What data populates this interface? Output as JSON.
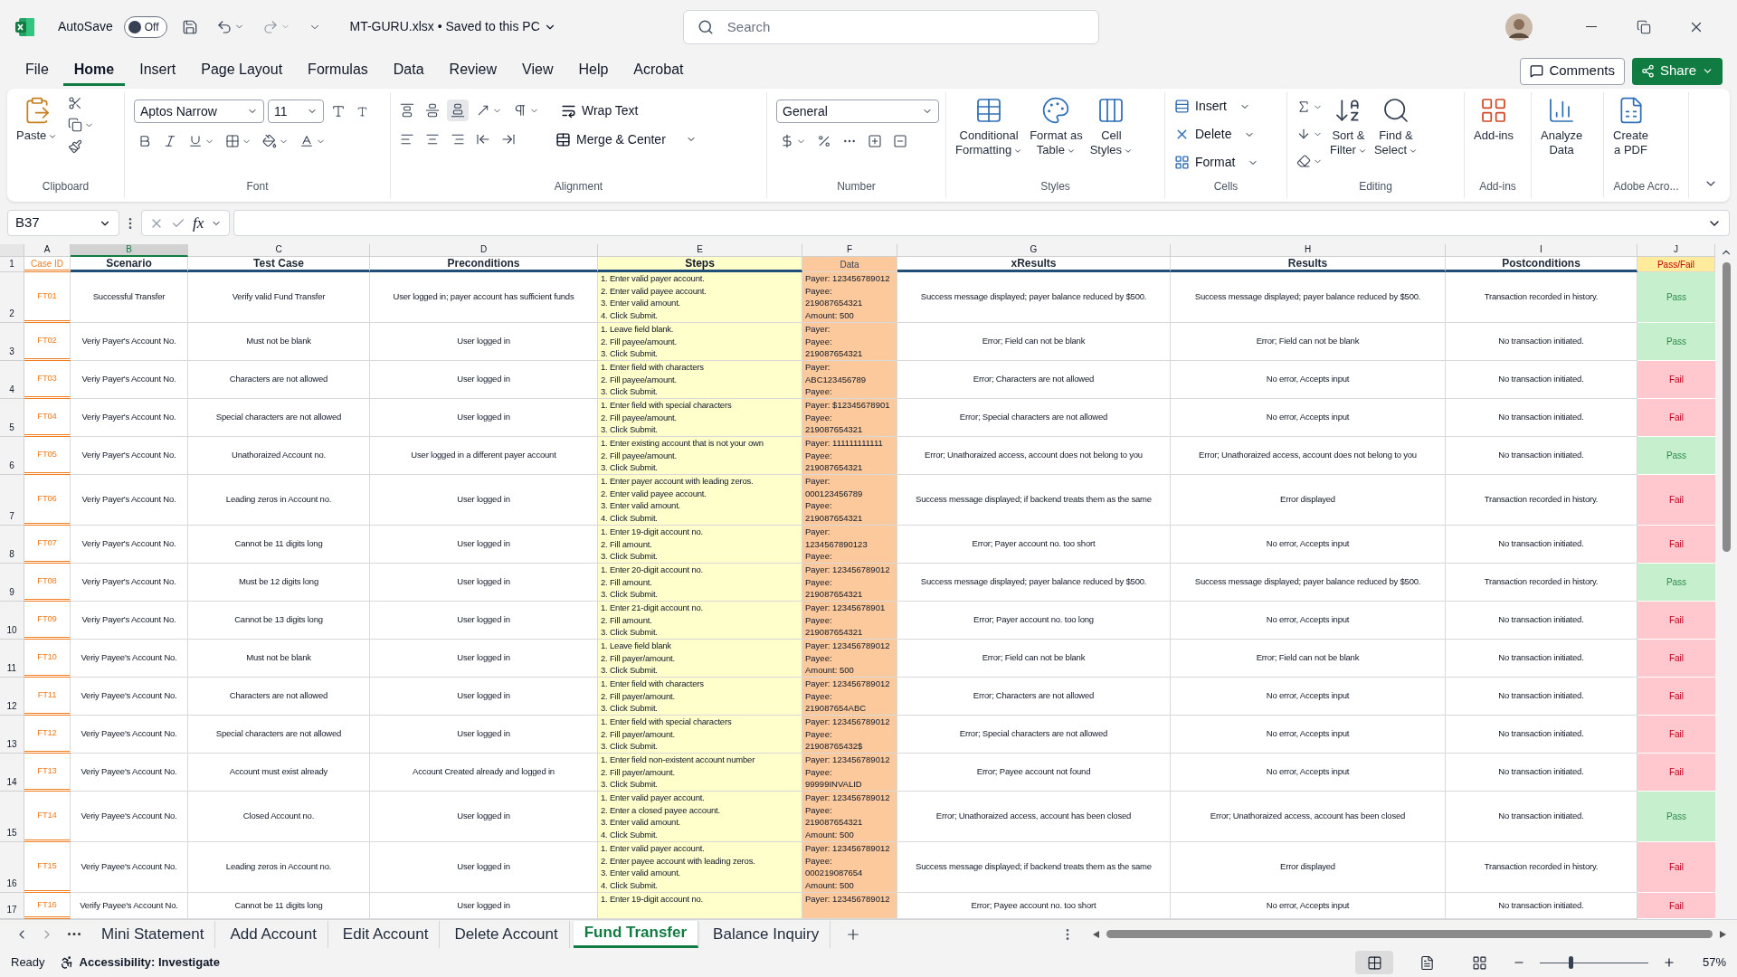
{
  "title_bar": {
    "autosave_label": "AutoSave",
    "autosave": {
      "on": false,
      "label": "Off"
    },
    "file_title": "MT-GURU.xlsx • Saved to this PC",
    "search_placeholder": "Search"
  },
  "menu": [
    {
      "label": "File",
      "selected": false
    },
    {
      "label": "Home",
      "selected": true
    },
    {
      "label": "Insert",
      "selected": false
    },
    {
      "label": "Page Layout",
      "selected": false
    },
    {
      "label": "Formulas",
      "selected": false
    },
    {
      "label": "Data",
      "selected": false
    },
    {
      "label": "Review",
      "selected": false
    },
    {
      "label": "View",
      "selected": false
    },
    {
      "label": "Help",
      "selected": false
    },
    {
      "label": "Acrobat",
      "selected": false
    }
  ],
  "actions": {
    "comments": "Comments",
    "share": "Share"
  },
  "ribbon": {
    "clipboard": {
      "name": "Clipboard",
      "paste": "Paste"
    },
    "font": {
      "name": "Font",
      "family": "Aptos Narrow",
      "size": "11"
    },
    "alignment": {
      "name": "Alignment",
      "wrap": "Wrap Text",
      "merge": "Merge & Center"
    },
    "number": {
      "name": "Number",
      "format": "General"
    },
    "styles": {
      "name": "Styles",
      "buttons": [
        {
          "lines": [
            "Conditional",
            "Formatting"
          ]
        },
        {
          "lines": [
            "Format as",
            "Table"
          ]
        },
        {
          "lines": [
            "Cell",
            "Styles"
          ]
        }
      ]
    },
    "cells": {
      "name": "Cells",
      "buttons": [
        "Insert",
        "Delete",
        "Format"
      ]
    },
    "editing": {
      "name": "Editing",
      "buttons": [
        {
          "lines": [
            "Sort &",
            "Filter"
          ]
        },
        {
          "lines": [
            "Find &",
            "Select"
          ]
        }
      ]
    },
    "addins": {
      "name": "Add-ins",
      "button": "Add-ins"
    },
    "analyze": {
      "lines": [
        "Analyze",
        "Data"
      ]
    },
    "adobe": {
      "name": "Adobe Acro...",
      "lines": [
        "Create",
        "a PDF"
      ]
    }
  },
  "formula_bar": {
    "name_box": "B37",
    "fx": "fx"
  },
  "columns": [
    {
      "label": "A",
      "selected": false
    },
    {
      "label": "B",
      "selected": true
    },
    {
      "label": "C",
      "selected": false
    },
    {
      "label": "D",
      "selected": false
    },
    {
      "label": "E",
      "selected": false
    },
    {
      "label": "F",
      "selected": false
    },
    {
      "label": "G",
      "selected": false
    },
    {
      "label": "H",
      "selected": false
    },
    {
      "label": "I",
      "selected": false
    },
    {
      "label": "J",
      "selected": false
    }
  ],
  "header_row": {
    "number": "1",
    "cells": [
      "Case ID",
      "Scenario",
      "Test Case",
      "Preconditions",
      "Steps",
      "Data",
      "xResults",
      "Results",
      "Postconditions",
      "Pass/Fail"
    ]
  },
  "rows": [
    {
      "number": "2",
      "id": "FT01",
      "scenario": "Successful Transfer",
      "test_case": "Verify valid Fund Transfer",
      "preconditions": "User logged in; payer account has sufficient funds",
      "steps": [
        "1. Enter valid payer account.",
        "2. Enter valid payee account.",
        "3. Enter valid amount.",
        "4. Click Submit."
      ],
      "data": [
        "Payer: 123456789012",
        "Payee:",
        "219087654321",
        "Amount: 500"
      ],
      "expected": "Success message displayed; payer balance reduced by $500.",
      "actual": "Success message displayed; payer balance reduced by $500.",
      "postconditions": "Transaction recorded in history.",
      "result": "Pass",
      "passed": true
    },
    {
      "number": "3",
      "id": "FT02",
      "scenario": "Veriy Payer's Account No.",
      "test_case": "Must not be blank",
      "preconditions": "User logged in",
      "steps": [
        "1. Leave field blank.",
        "2. Fill payee/amount.",
        "3. Click Submit."
      ],
      "data": [
        "Payer:",
        "Payee:",
        "219087654321"
      ],
      "expected": "Error; Field can not be blank",
      "actual": "Error; Field can not be blank",
      "postconditions": "No transaction initiated.",
      "result": "Pass",
      "passed": true
    },
    {
      "number": "4",
      "id": "FT03",
      "scenario": "Veriy Payer's Account No.",
      "test_case": "Characters are not allowed",
      "preconditions": "User logged in",
      "steps": [
        "1. Enter field with characters",
        "2. Fill payee/amount.",
        "3. Click Submit."
      ],
      "data": [
        "Payer:",
        "ABC123456789",
        "Payee:"
      ],
      "expected": "Error; Characters are not allowed",
      "actual": "No error, Accepts input",
      "postconditions": "No transaction initiated.",
      "result": "Fail",
      "passed": false
    },
    {
      "number": "5",
      "id": "FT04",
      "scenario": "Veriy Payer's Account No.",
      "test_case": "Special characters are not allowed",
      "preconditions": "User logged in",
      "steps": [
        "1. Enter field with special characters",
        "2. Fill payee/amount.",
        "3. Click Submit."
      ],
      "data": [
        "Payer: $12345678901",
        "Payee:",
        "219087654321"
      ],
      "expected": "Error; Special characters are not allowed",
      "actual": "No error, Accepts input",
      "postconditions": "No transaction initiated.",
      "result": "Fail",
      "passed": false
    },
    {
      "number": "6",
      "id": "FT05",
      "scenario": "Veriy Payer's Account No.",
      "test_case": "Unathoraized Account no.",
      "preconditions": "User logged in a different payer account",
      "steps": [
        "1. Enter existing account that is not your own",
        "2. Fill payee/amount.",
        "3. Click Submit."
      ],
      "data": [
        "Payer: 111111111111",
        "Payee:",
        "219087654321"
      ],
      "expected": "Error; Unathoraized access, account does not belong to you",
      "actual": "Error; Unathoraized access, account does not belong to you",
      "postconditions": "No transaction initiated.",
      "result": "Pass",
      "passed": true
    },
    {
      "number": "7",
      "id": "FT06",
      "scenario": "Veriy Payer's Account No.",
      "test_case": "Leading zeros in Account no.",
      "preconditions": "User logged in",
      "steps": [
        "1. Enter payer account with leading zeros.",
        "2. Enter valid payee account.",
        "3. Enter valid amount.",
        "4. Click Submit."
      ],
      "data": [
        "Payer:",
        "000123456789",
        "Payee:",
        "219087654321"
      ],
      "expected": "Success message displayed; if backend treats them as the same",
      "actual": "Error displayed",
      "postconditions": "Transaction recorded in history.",
      "result": "Fail",
      "passed": false
    },
    {
      "number": "8",
      "id": "FT07",
      "scenario": "Veriy Payer's Account No.",
      "test_case": "Cannot be 11 digits long",
      "preconditions": "User logged in",
      "steps": [
        "1. Enter 19-digit account no.",
        "2. Fill amount.",
        "3. Click Submit."
      ],
      "data": [
        "Payer:",
        "1234567890123",
        "Payee:"
      ],
      "expected": "Error; Payer account no. too short",
      "actual": "No error, Accepts input",
      "postconditions": "No transaction initiated.",
      "result": "Fail",
      "passed": false
    },
    {
      "number": "9",
      "id": "FT08",
      "scenario": "Veriy Payer's Account No.",
      "test_case": "Must be 12 digits long",
      "preconditions": "User logged in",
      "steps": [
        "1. Enter 20-digit account no.",
        "2. Fill amount.",
        "3. Click Submit."
      ],
      "data": [
        "Payer: 123456789012",
        "Payee:",
        "219087654321"
      ],
      "expected": "Success message displayed; payer balance reduced by $500.",
      "actual": "Success message displayed; payer balance reduced by $500.",
      "postconditions": "Transaction recorded in history.",
      "result": "Pass",
      "passed": true
    },
    {
      "number": "10",
      "id": "FT09",
      "scenario": "Veriy Payer's Account No.",
      "test_case": "Cannot be 13 digits long",
      "preconditions": "User logged in",
      "steps": [
        "1. Enter 21-digit account no.",
        "2. Fill amount.",
        "3. Click Submit."
      ],
      "data": [
        "Payer: 12345678901",
        "Payee:",
        "219087654321"
      ],
      "expected": "Error; Payer account no. too long",
      "actual": "No error, Accepts input",
      "postconditions": "No transaction initiated.",
      "result": "Fail",
      "passed": false
    },
    {
      "number": "11",
      "id": "FT10",
      "scenario": "Veriy Payee's Account No.",
      "test_case": "Must not be blank",
      "preconditions": "User logged in",
      "steps": [
        "1. Leave field blank",
        "2. Fill payer/amount.",
        "3. Click Submit."
      ],
      "data": [
        "Payer: 123456789012",
        "Payee:",
        "Amount: 500"
      ],
      "expected": "Error; Field can not be blank",
      "actual": "Error; Field can not be blank",
      "postconditions": "No transaction initiated.",
      "result": "Fail",
      "passed": false
    },
    {
      "number": "12",
      "id": "FT11",
      "scenario": "Veriy Payee's Account No.",
      "test_case": "Characters are not allowed",
      "preconditions": "User logged in",
      "steps": [
        "1. Enter field with characters",
        "2. Fill payer/amount.",
        "3. Click Submit."
      ],
      "data": [
        "Payer: 123456789012",
        "Payee:",
        "219087654ABC"
      ],
      "expected": "Error; Characters are not allowed",
      "actual": "No error, Accepts input",
      "postconditions": "No transaction initiated.",
      "result": "Fail",
      "passed": false
    },
    {
      "number": "13",
      "id": "FT12",
      "scenario": "Veriy Payee's Account No.",
      "test_case": "Special characters are not allowed",
      "preconditions": "User logged in",
      "steps": [
        "1. Enter field with special characters",
        "2. Fill payer/amount.",
        "3. Click Submit."
      ],
      "data": [
        "Payer: 123456789012",
        "Payee:",
        "21908765432$"
      ],
      "expected": "Error; Special characters are not allowed",
      "actual": "No error, Accepts input",
      "postconditions": "No transaction initiated.",
      "result": "Fail",
      "passed": false
    },
    {
      "number": "14",
      "id": "FT13",
      "scenario": "Veriy Payee's Account No.",
      "test_case": "Account must exist already",
      "preconditions": "Account Created already and logged in",
      "steps": [
        "1. Enter field non-existent account number",
        "2. Fill payer/amount.",
        "3. Click Submit."
      ],
      "data": [
        "Payer: 123456789012",
        "Payee:",
        "99999INVALID"
      ],
      "expected": "Error; Payee account not found",
      "actual": "No error, Accepts input",
      "postconditions": "No transaction initiated.",
      "result": "Fail",
      "passed": false
    },
    {
      "number": "15",
      "id": "FT14",
      "scenario": "Veriy Payee's Account No.",
      "test_case": "Closed Account no.",
      "preconditions": "User logged in",
      "steps": [
        "1. Enter valid payer account.",
        "2. Enter a closed payee account.",
        "3. Enter valid amount.",
        "4. Click Submit."
      ],
      "data": [
        "Payer: 123456789012",
        "Payee:",
        "219087654321",
        "Amount: 500"
      ],
      "expected": "Error; Unathoraized access, account has been closed",
      "actual": "Error; Unathoraized access, account has been closed",
      "postconditions": "No transaction initiated.",
      "result": "Pass",
      "passed": true
    },
    {
      "number": "16",
      "id": "FT15",
      "scenario": "Veriy Payee's Account No.",
      "test_case": "Leading zeros in Account no.",
      "preconditions": "User logged in",
      "steps": [
        "1. Enter valid payer account.",
        "2. Enter payee account with leading zeros.",
        "3. Enter valid amount.",
        "4. Click Submit."
      ],
      "data": [
        "Payer: 123456789012",
        "Payee:",
        "000219087654",
        "Amount: 500"
      ],
      "expected": "Success message displayed; if backend treats them as the same",
      "actual": "Error displayed",
      "postconditions": "Transaction recorded in history.",
      "result": "Fail",
      "passed": false
    },
    {
      "number": "17",
      "id": "FT16",
      "scenario": "Verify Payee's Account No.",
      "test_case": "Cannot be 11 digits long",
      "preconditions": "User logged in",
      "steps": [
        "1. Enter 19-digit account no."
      ],
      "data": [
        "Payer: 123456789012"
      ],
      "expected": "Error; Payee account no. too short",
      "actual": "No error, Accepts input",
      "postconditions": "No transaction initiated.",
      "result": "Fail",
      "passed": false
    }
  ],
  "sheet_tabs": [
    {
      "label": "Mini Statement",
      "selected": false
    },
    {
      "label": "Add Account",
      "selected": false
    },
    {
      "label": "Edit Account",
      "selected": false
    },
    {
      "label": "Delete Account",
      "selected": false
    },
    {
      "label": "Fund Transfer",
      "selected": true
    },
    {
      "label": "Balance Inquiry",
      "selected": false
    }
  ],
  "status_bar": {
    "ready": "Ready",
    "accessibility": "Accessibility: Investigate",
    "views": [
      {
        "kind": "normal",
        "selected": true
      },
      {
        "kind": "page_layout",
        "selected": false
      },
      {
        "kind": "page_break",
        "selected": false
      }
    ],
    "zoom_slider": {
      "level": 0.28
    },
    "zoom": "57%"
  }
}
